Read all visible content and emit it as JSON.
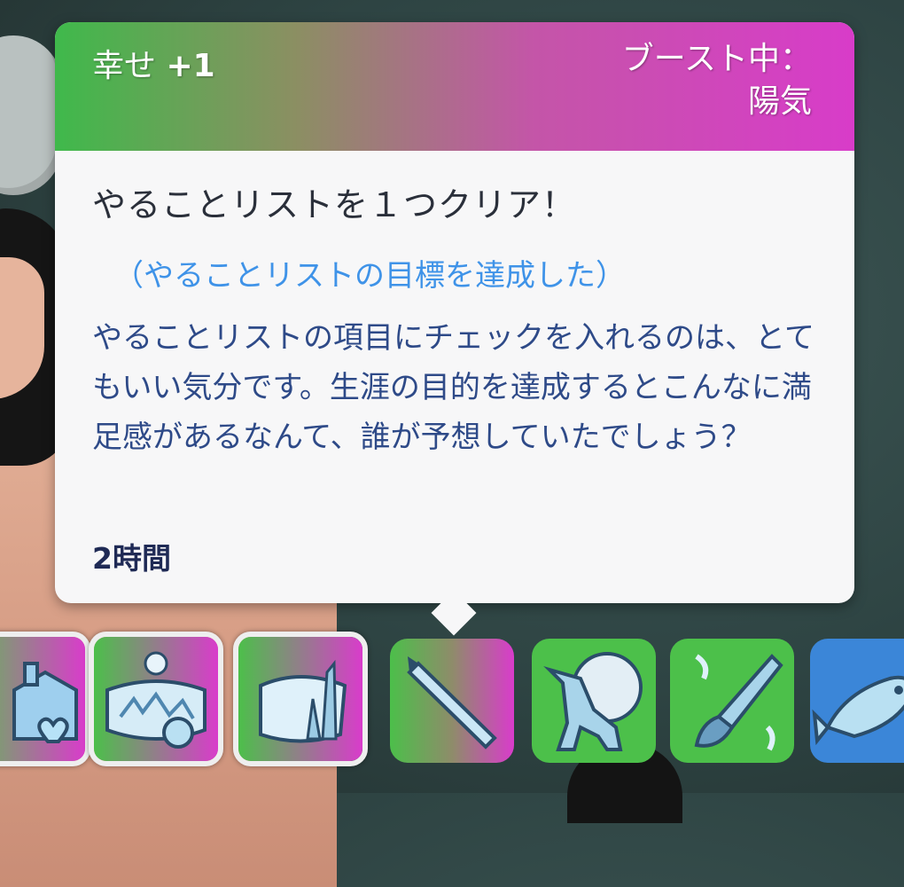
{
  "tooltip": {
    "emotion_label": "幸せ",
    "emotion_value": "+1",
    "boost_label": "ブースト中：",
    "boost_value": "陽気",
    "title": "やることリストを１つクリア！",
    "subtitle": "（やることリストの目標を達成した）",
    "description": "やることリストの項目にチェックを入れるのは、とてもいい気分です。生涯の目的を達成するとこんなに満足感があるなんて、誰が予想していたでしょう？",
    "duration": "2時間"
  },
  "moodlets": [
    {
      "icon": "house-heart-icon",
      "theme": "happy-magenta",
      "selected": true
    },
    {
      "icon": "snowy-landscape-icon",
      "theme": "green-magenta",
      "selected": true
    },
    {
      "icon": "frozen-pond-icon",
      "theme": "green-magenta",
      "selected": true
    },
    {
      "icon": "pencil-icon",
      "theme": "green-magenta",
      "selected": false
    },
    {
      "icon": "wolf-moon-icon",
      "theme": "green",
      "selected": false
    },
    {
      "icon": "paintbrush-icon",
      "theme": "green",
      "selected": false
    },
    {
      "icon": "fish-icon",
      "theme": "blue",
      "selected": false
    }
  ],
  "colors": {
    "header_start": "#3fb94b",
    "header_end": "#d83cc9",
    "subtitle": "#3f93e8",
    "description": "#2e4a88",
    "moodlet_blue": "#3b86d8"
  }
}
